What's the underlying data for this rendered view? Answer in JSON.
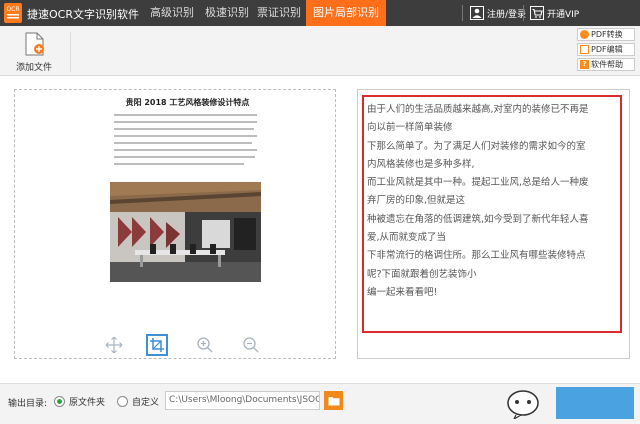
{
  "app": {
    "logo_text": "OCR",
    "title": "捷速OCR文字识别软件",
    "tabs": [
      {
        "label": "高级识别",
        "active": false
      },
      {
        "label": "极速识别",
        "active": false
      },
      {
        "label": "票证识别",
        "active": false
      },
      {
        "label": "图片局部识别",
        "active": true
      }
    ],
    "login_label": "注册/登录",
    "vip_label": "开通VIP"
  },
  "toolbar": {
    "add_file_label": "添加文件",
    "side_buttons": [
      {
        "label": "PDF转换",
        "icon": "pdf-convert-icon"
      },
      {
        "label": "PDF编辑",
        "icon": "pdf-edit-icon"
      },
      {
        "label": "软件帮助",
        "icon": "help-icon"
      }
    ]
  },
  "preview": {
    "doc_title": "贵阳 2018 工艺风格装修设计特点"
  },
  "result": {
    "lines": [
      "由于人们的生活品质越来越高,对室内的装修已不再是",
      "向以前一样简单装修",
      "下那么简单了。为了满足人们对装修的需求如今的室",
      "内风格装修也是多种多样,",
      "而工业风就是其中一种。提起工业风,总是给人一种废",
      "弃厂房的印象,但就是这",
      "种被遗忘在角落的低调建筑,如今受到了新代年轻人喜",
      "爱,从而就变成了当",
      "下非常流行的格调住所。那么工业风有哪些装修特点",
      "呢?下面就跟着创艺装饰小",
      "编一起来看看吧!"
    ]
  },
  "bottom": {
    "output_label": "输出目录:",
    "option_original": "原文件夹",
    "option_custom": "自定义",
    "selected": "原文件夹",
    "path_value": "C:\\Users\\Mloong\\Documents\\JSOC"
  },
  "colors": {
    "titlebar": "#3d3d3d",
    "accent": "#ff6f1a",
    "highlight_border": "#d92b2b",
    "radio_on": "#2aa64a"
  }
}
